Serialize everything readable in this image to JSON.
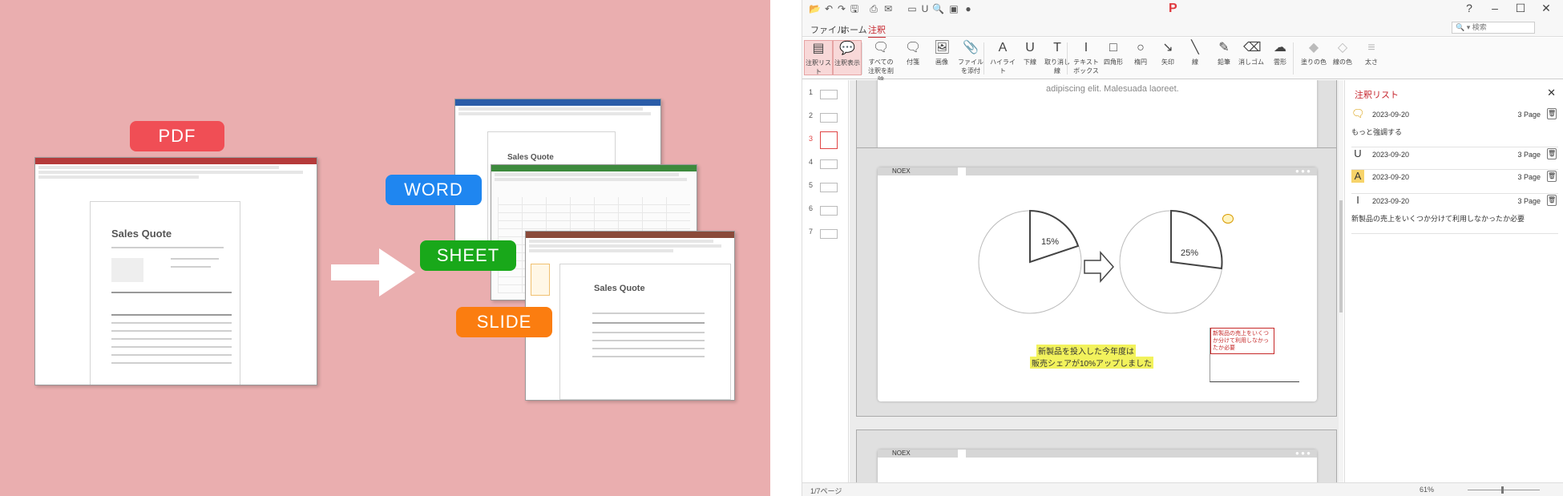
{
  "promo": {
    "badges": {
      "pdf": "PDF",
      "word": "WORD",
      "sheet": "SHEET",
      "slide": "SLIDE"
    },
    "doc_title": "Sales Quote",
    "colors": {
      "pdf": "#f04e55",
      "word": "#1f86f0",
      "sheet": "#19a81a",
      "slide": "#fb7d10",
      "background": "#eaaeaf"
    }
  },
  "app": {
    "logo": "P",
    "window_controls": [
      "?",
      "–",
      "☐",
      "✕"
    ],
    "menu_tabs": [
      "ファイル",
      "ホーム",
      "注釈"
    ],
    "active_tab": "注釈",
    "search_placeholder": "検索",
    "ribbon": [
      {
        "label": "注釈リスト",
        "icon": "annotation-list-icon",
        "glyph": "▤",
        "selected": true
      },
      {
        "label": "注釈表示",
        "icon": "annotation-show-icon",
        "glyph": "💬",
        "selected": true
      },
      {
        "label": "すべての注釈を削除",
        "icon": "delete-all-annotations-icon",
        "glyph": "🗨"
      },
      {
        "label": "付箋",
        "icon": "sticky-note-icon",
        "glyph": "🗨"
      },
      {
        "label": "画像",
        "icon": "image-icon",
        "glyph": "🖼"
      },
      {
        "label": "ファイルを添付",
        "icon": "attach-file-icon",
        "glyph": "📎"
      },
      {
        "label": "ハイライト",
        "icon": "highlight-icon",
        "glyph": "A"
      },
      {
        "label": "下線",
        "icon": "underline-icon",
        "glyph": "U"
      },
      {
        "label": "取り消し線",
        "icon": "strikethrough-icon",
        "glyph": "T"
      },
      {
        "label": "テキストボックス",
        "icon": "textbox-icon",
        "glyph": "I"
      },
      {
        "label": "四角形",
        "icon": "rectangle-icon",
        "glyph": "□"
      },
      {
        "label": "楕円",
        "icon": "ellipse-icon",
        "glyph": "○"
      },
      {
        "label": "矢印",
        "icon": "arrow-icon",
        "glyph": "↘"
      },
      {
        "label": "線",
        "icon": "line-icon",
        "glyph": "╲"
      },
      {
        "label": "鉛筆",
        "icon": "pencil-icon",
        "glyph": "✎"
      },
      {
        "label": "消しゴム",
        "icon": "eraser-icon",
        "glyph": "⌫"
      },
      {
        "label": "雲形",
        "icon": "cloud-icon",
        "glyph": "☁"
      },
      {
        "label": "塗りの色",
        "icon": "fill-color-icon",
        "glyph": "◆"
      },
      {
        "label": "線の色",
        "icon": "line-color-icon",
        "glyph": "◇"
      },
      {
        "label": "太さ",
        "icon": "line-width-icon",
        "glyph": "≡"
      }
    ],
    "thumbnails": [
      "1",
      "2",
      "3",
      "4",
      "5",
      "6",
      "7"
    ],
    "current_thumb": "3",
    "page_top_text": "adipiscing elit. Malesuada laoreet.",
    "slide_brand": "NOEX",
    "pie_left": "15%",
    "pie_right": "25%",
    "highlight_text_1": "新製品を投入した今年度は",
    "highlight_text_2": "販売シェアが10%アップしました",
    "callout_text": "新製品の売上をいくつか分けて利用しなかったか必要",
    "side_panel": {
      "title": "注釈リスト",
      "close": "✕",
      "items": [
        {
          "icon": "sticky-note-icon",
          "glyph": "🗨",
          "date": "2023-09-20",
          "page": "3 Page",
          "comment": "もっと強調する"
        },
        {
          "icon": "underline-icon",
          "glyph": "U",
          "date": "2023-09-20",
          "page": "3 Page",
          "comment": ""
        },
        {
          "icon": "highlight-icon",
          "glyph": "A",
          "date": "2023-09-20",
          "page": "3 Page",
          "comment": ""
        },
        {
          "icon": "textbox-icon",
          "glyph": "I",
          "date": "2023-09-20",
          "page": "3 Page",
          "comment": "新製品の売上をいくつか分けて利用しなかったか必要"
        }
      ]
    },
    "status": {
      "page": "1/7ページ",
      "zoom": "61%"
    }
  }
}
